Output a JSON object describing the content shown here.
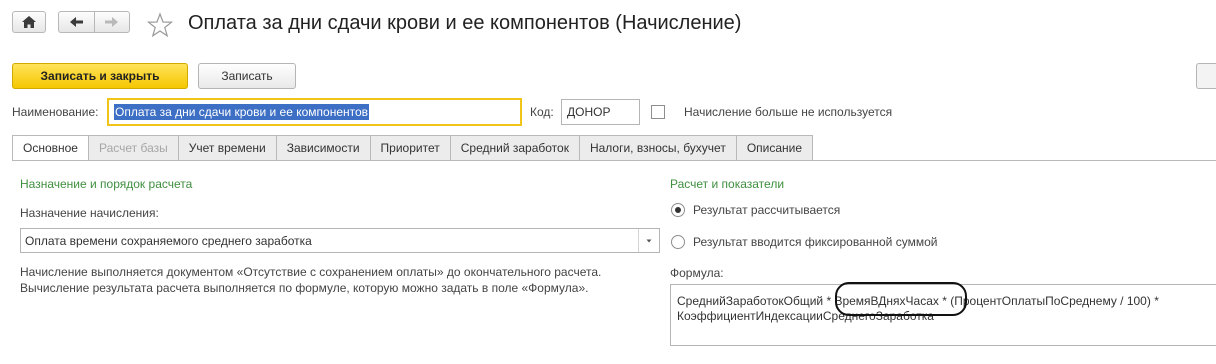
{
  "header": {
    "title": "Оплата за дни сдачи крови и ее компонентов (Начисление)"
  },
  "toolbar": {
    "save_close_label": "Записать и закрыть",
    "save_label": "Записать"
  },
  "form": {
    "name_label": "Наименование:",
    "name_value": "Оплата за дни сдачи крови и ее компонентов",
    "code_label": "Код:",
    "code_value": "ДОНОР",
    "not_used_label": "Начисление больше не используется",
    "not_used_checked": false
  },
  "tabs": [
    {
      "label": "Основное",
      "state": "active"
    },
    {
      "label": "Расчет базы",
      "state": "disabled"
    },
    {
      "label": "Учет времени",
      "state": "normal"
    },
    {
      "label": "Зависимости",
      "state": "normal"
    },
    {
      "label": "Приоритет",
      "state": "normal"
    },
    {
      "label": "Средний заработок",
      "state": "normal"
    },
    {
      "label": "Налоги, взносы, бухучет",
      "state": "normal"
    },
    {
      "label": "Описание",
      "state": "normal"
    }
  ],
  "left": {
    "section_title": "Назначение и порядок расчета",
    "purpose_label": "Назначение начисления:",
    "purpose_value": "Оплата времени сохраняемого среднего заработка",
    "info_line1": "Начисление выполняется документом «Отсутствие с сохранением оплаты» до окончательного расчета.",
    "info_line2": "Вычисление результата расчета выполняется по формуле, которую можно задать в поле «Формула»."
  },
  "right": {
    "section_title": "Расчет и показатели",
    "radio_calc": "Результат рассчитывается",
    "radio_fixed": "Результат вводится фиксированной суммой",
    "selected": "calc",
    "formula_label": "Формула:",
    "formula_part1": "СреднийЗаработокОбщий * ",
    "formula_highlight": "ВремяВДняхЧасах",
    "formula_part2": " * (ПроцентОплатыПоСреднему / 100) *",
    "formula_line2": "КоэффициентИндексацииСреднегоЗаработка"
  },
  "colors": {
    "accent_yellow": "#f5c700",
    "section_green": "#3f8f3f",
    "selection_blue": "#3d6fc4"
  }
}
